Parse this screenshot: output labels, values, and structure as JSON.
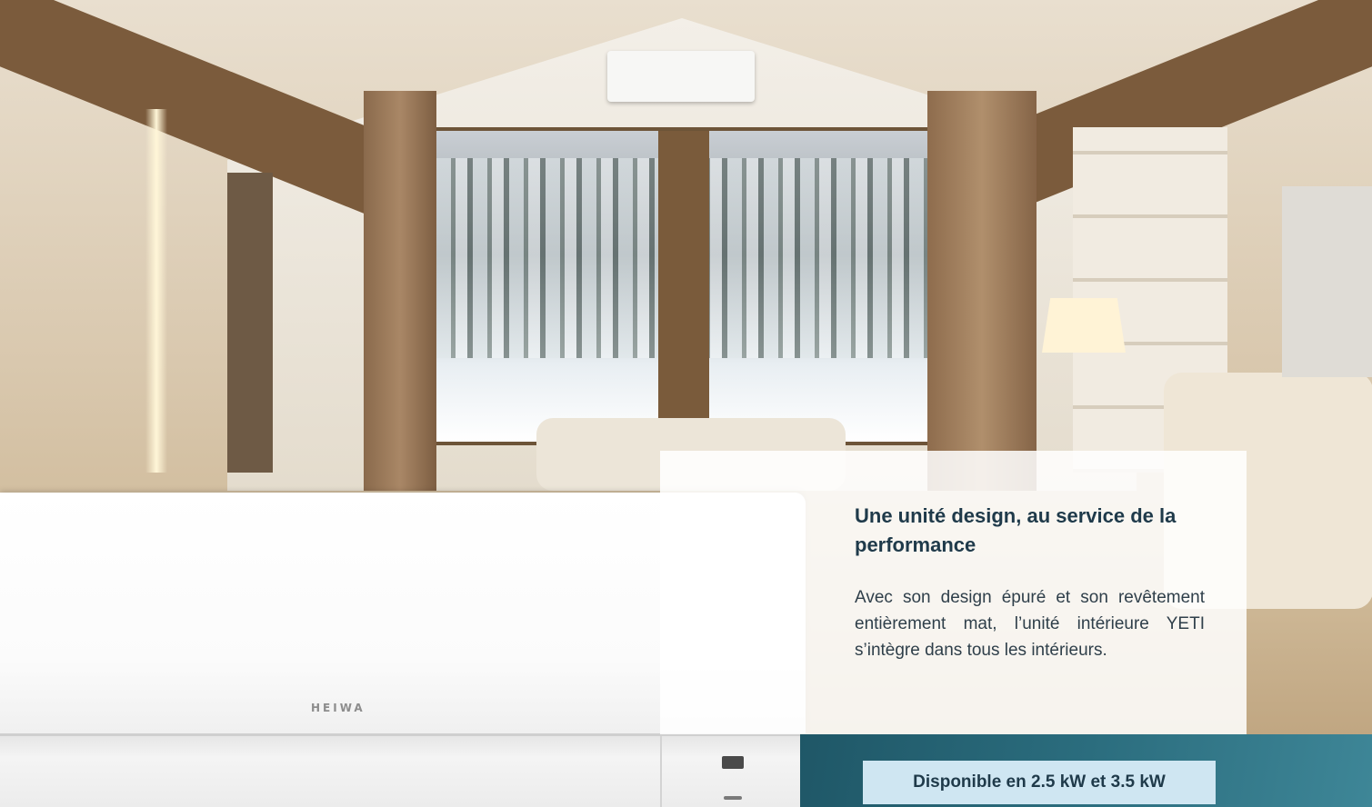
{
  "hero": {
    "product_brand": "HEIWA"
  },
  "feature_card": {
    "title": "Une unité design, au service de la performance",
    "body": "Avec son design épuré et son revêtement entièrement mat, l’unité intérieure YETI s’intègre dans tous les intérieurs."
  },
  "availability_badge": {
    "label": "Disponible en 2.5 kW et 3.5 kW"
  },
  "colors": {
    "accent_teal": "#1f5767",
    "badge_bg": "#cfe6f2",
    "title_text": "#1f3a4a"
  }
}
